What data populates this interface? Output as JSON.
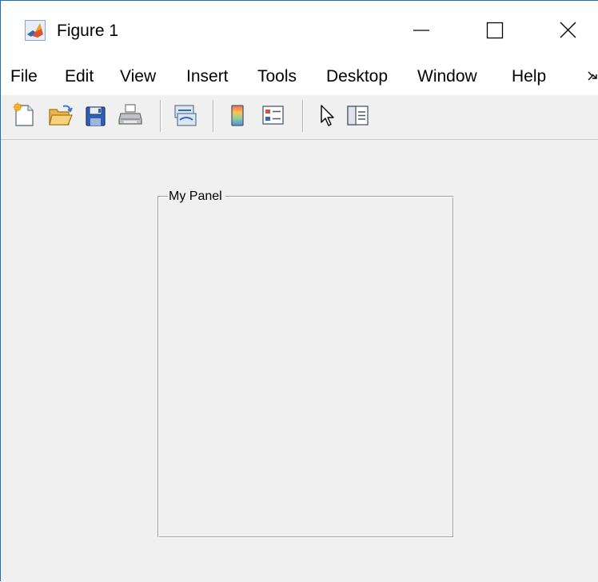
{
  "window": {
    "title": "Figure 1",
    "icon": "matlab-logo-icon",
    "controls": [
      "minimize-icon",
      "maximize-icon",
      "close-icon"
    ]
  },
  "menubar": {
    "items": [
      {
        "label": "File"
      },
      {
        "label": "Edit"
      },
      {
        "label": "View"
      },
      {
        "label": "Insert"
      },
      {
        "label": "Tools"
      },
      {
        "label": "Desktop"
      },
      {
        "label": "Window"
      },
      {
        "label": "Help"
      }
    ],
    "overflow_icon": "menu-overflow-icon"
  },
  "toolbar": {
    "buttons": [
      "new-figure-icon",
      "open-file-icon",
      "save-figure-icon",
      "print-figure-icon",
      "link-plot-icon",
      "insert-colorbar-icon",
      "insert-legend-icon",
      "edit-plot-icon",
      "open-property-inspector-icon"
    ]
  },
  "panel": {
    "title": "My Panel"
  },
  "colors": {
    "window_border": "#1f6fb3",
    "background": "#f0f0f0",
    "titlebar": "#ffffff",
    "panel_border_dark": "#a0a0a0",
    "panel_border_light": "#ffffff"
  }
}
